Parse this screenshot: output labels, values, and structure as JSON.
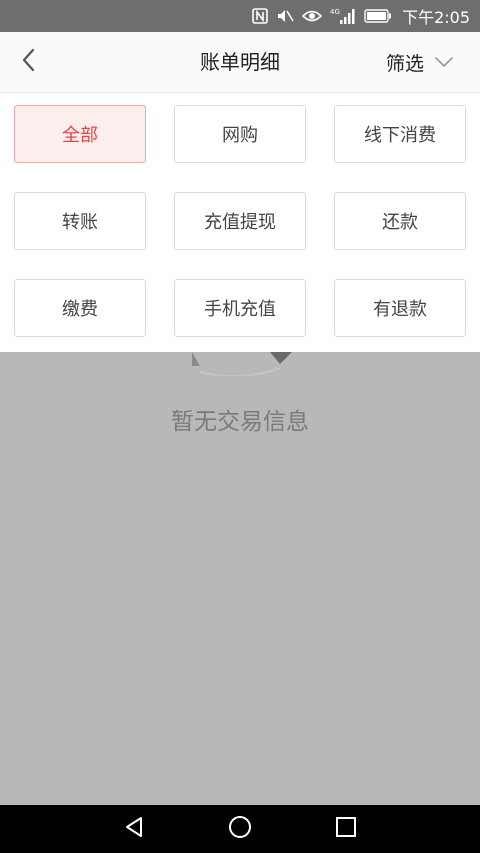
{
  "status_bar": {
    "time": "下午2:05",
    "network": "4G",
    "icons": [
      "nfc-icon",
      "mute-icon",
      "eye-icon",
      "signal-icon",
      "battery-icon"
    ]
  },
  "header": {
    "title": "账单明细",
    "filter_label": "筛选",
    "back_icon": "chevron-left-icon",
    "filter_icon": "chevron-down-icon"
  },
  "filter": {
    "options": [
      {
        "label": "全部",
        "active": true
      },
      {
        "label": "网购",
        "active": false
      },
      {
        "label": "线下消费",
        "active": false
      },
      {
        "label": "转账",
        "active": false
      },
      {
        "label": "充值提现",
        "active": false
      },
      {
        "label": "还款",
        "active": false
      },
      {
        "label": "缴费",
        "active": false
      },
      {
        "label": "手机充值",
        "active": false
      },
      {
        "label": "有退款",
        "active": false
      }
    ]
  },
  "empty_state": {
    "message": "暂无交易信息"
  },
  "nav_bar": {
    "buttons": [
      "back-triangle-icon",
      "home-circle-icon",
      "recents-square-icon"
    ]
  },
  "colors": {
    "accent": "#e64340",
    "active_bg": "#fdeeee",
    "overlay": "#b8b8b8",
    "status_bar": "#6e6e6e"
  }
}
